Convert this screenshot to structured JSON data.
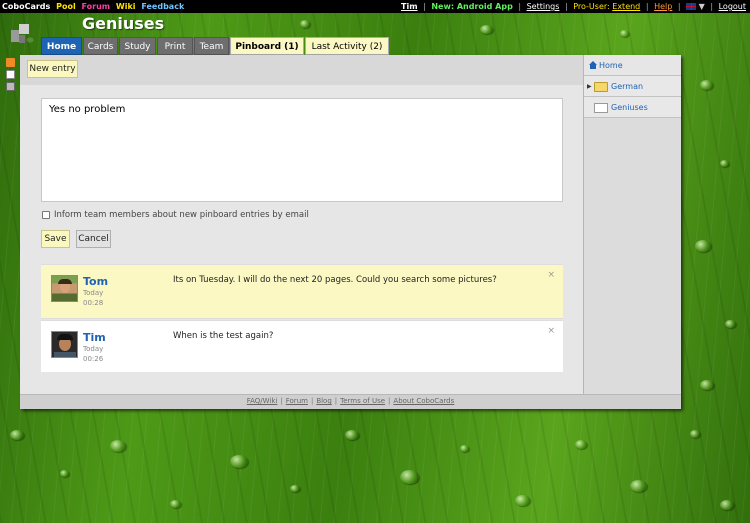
{
  "topbar": {
    "brand": "CoboCards",
    "links": [
      {
        "label": "Pool",
        "color": "#ffe400"
      },
      {
        "label": "Forum",
        "color": "#ff3ea5"
      },
      {
        "label": "Wiki",
        "color": "#ffe400"
      },
      {
        "label": "Feedback",
        "color": "#6ec6ff"
      }
    ],
    "user": "Tim",
    "android": "New: Android App",
    "settings": "Settings",
    "pro_label": "Pro-User:",
    "extend": "Extend",
    "help": "Help",
    "language_flag": "uk-flag-icon",
    "logout": "Logout"
  },
  "header": {
    "title": "Geniuses"
  },
  "tabs": [
    {
      "label": "Home",
      "state": "active"
    },
    {
      "label": "Cards",
      "state": "normal"
    },
    {
      "label": "Study",
      "state": "normal"
    },
    {
      "label": "Print",
      "state": "normal"
    },
    {
      "label": "Team",
      "state": "normal"
    },
    {
      "label": "Pinboard (1)",
      "state": "selected"
    },
    {
      "label": "Last Activity (2)",
      "state": "selected"
    }
  ],
  "toolbar": {
    "new_entry": "New entry"
  },
  "editor": {
    "text": "Yes no problem",
    "inform_label": "Inform team members about new pinboard entries by email",
    "save": "Save",
    "cancel": "Cancel"
  },
  "entries": [
    {
      "name": "Tom",
      "day": "Today",
      "time": "00:28",
      "message": "Its on Tuesday. I will do the next 20 pages. Could you search some pictures?",
      "highlight": true
    },
    {
      "name": "Tim",
      "day": "Today",
      "time": "00:26",
      "message": "When is the test again?",
      "highlight": false
    }
  ],
  "sidebar": {
    "items": [
      {
        "label": "Home",
        "icon": "home-icon"
      },
      {
        "label": "German",
        "icon": "folder-icon"
      },
      {
        "label": "Geniuses",
        "icon": "cardset-icon"
      }
    ]
  },
  "footer": {
    "links": [
      "FAQ/Wiki",
      "Forum",
      "Blog",
      "Terms of Use",
      "About CoboCards"
    ]
  },
  "colors": {
    "accent": "#1f63b4",
    "highlight": "#fbf8c4"
  }
}
